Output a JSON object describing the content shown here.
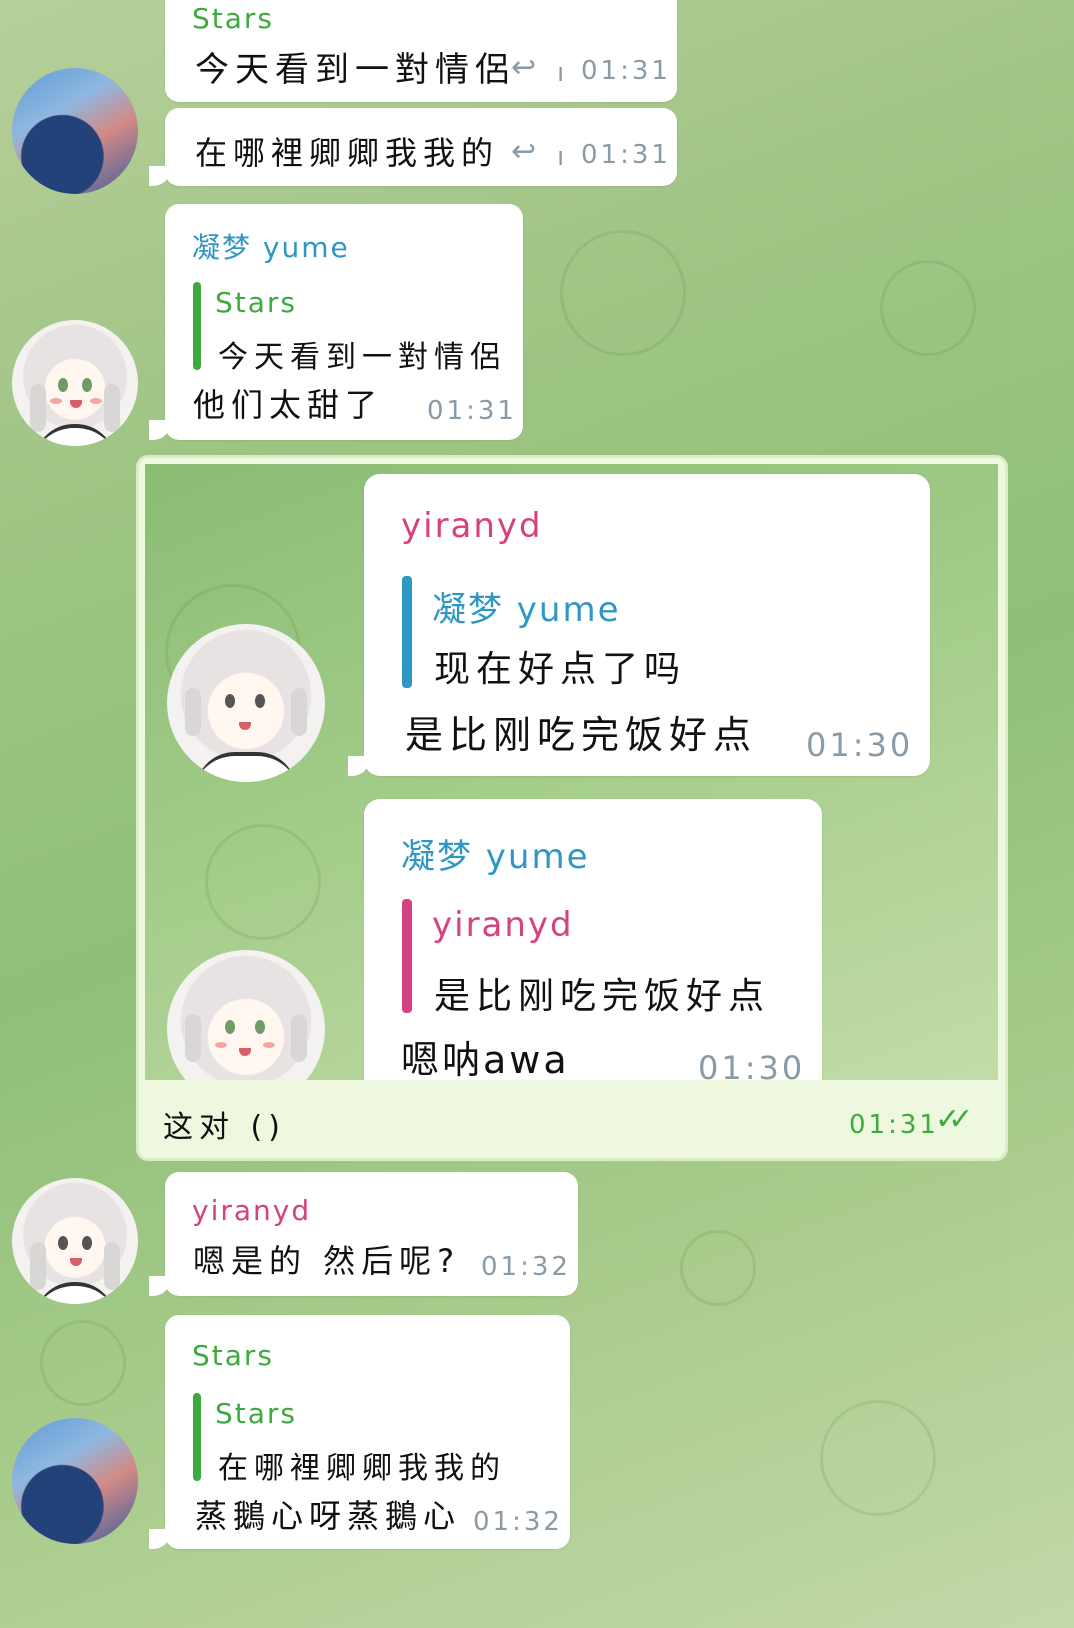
{
  "messages": [
    {
      "sender": "Stars",
      "text": "今天看到一對情侶",
      "time": "01:31",
      "reply_icon": "↩",
      "divider": "ı"
    },
    {
      "text": "在哪裡卿卿我我的",
      "time": "01:31",
      "reply_icon": "↩",
      "divider": "ı"
    },
    {
      "sender": "凝梦 yume",
      "reply_sender": "Stars",
      "reply_text": "今天看到一對情侶",
      "text": "他们太甜了",
      "time": "01:31"
    },
    {
      "sender": "yiranyd",
      "text": "嗯是的 然后呢?",
      "time": "01:32"
    },
    {
      "sender": "Stars",
      "reply_sender": "Stars",
      "reply_text": "在哪裡卿卿我我的",
      "text": "蒸鵝心呀蒸鵝心",
      "time": "01:32"
    }
  ],
  "quote": {
    "inner": [
      {
        "sender": "yiranyd",
        "reply_sender": "凝梦 yume",
        "reply_text": "现在好点了吗",
        "text": "是比刚吃完饭好点",
        "time": "01:30"
      },
      {
        "sender": "凝梦 yume",
        "reply_sender": "yiranyd",
        "reply_text": "是比刚吃完饭好点",
        "text": "嗯呐awa",
        "time": "01:30"
      }
    ],
    "caption": "这对 ()",
    "time": "01:31",
    "read_icon": "✓✓"
  },
  "colors": {
    "stars": "#3daa3d",
    "yume": "#2f97c4",
    "yiranyd": "#d6417f",
    "read": "#3daa3d"
  },
  "icons": [
    "reply-icon",
    "double-check-icon"
  ]
}
